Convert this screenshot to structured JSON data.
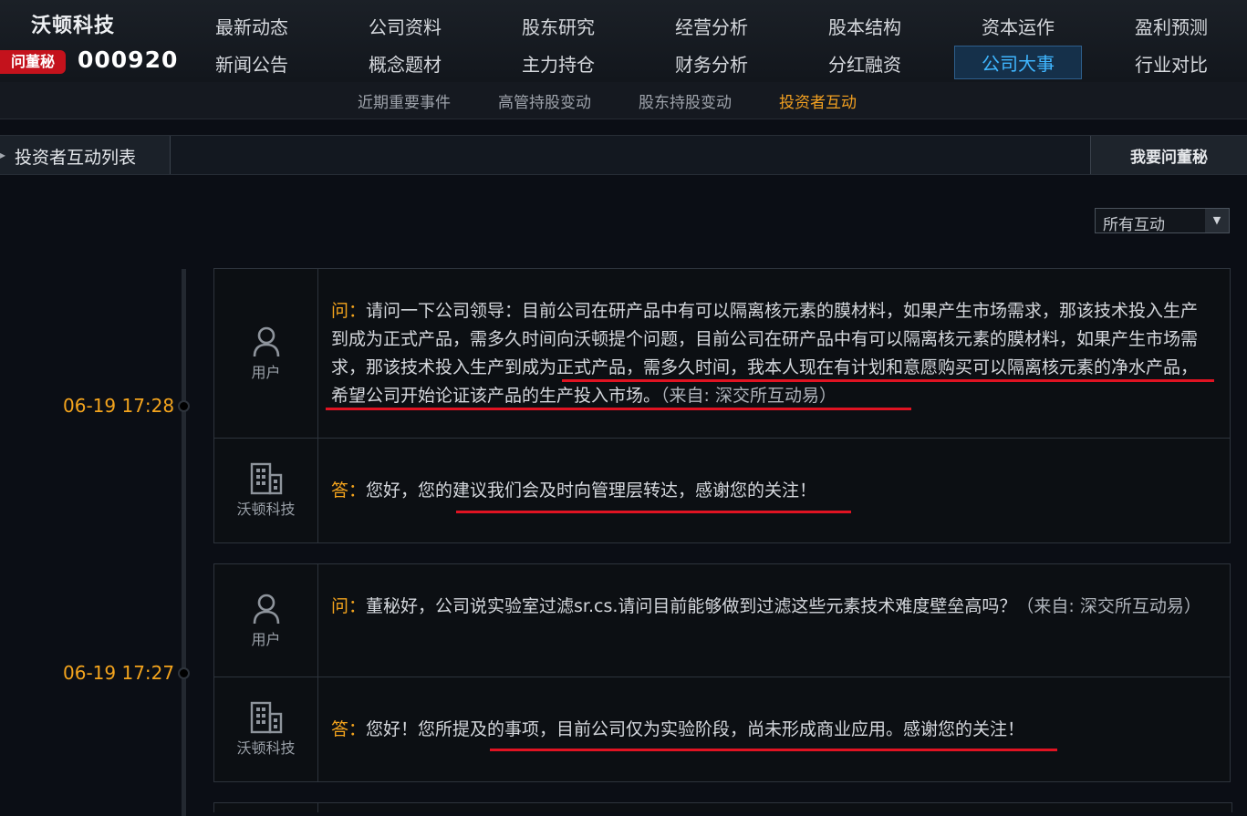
{
  "header": {
    "company_name": "沃顿科技",
    "badge_label": "问董秘",
    "stock_code": "000920"
  },
  "nav": {
    "row1": [
      "最新动态",
      "公司资料",
      "股东研究",
      "经营分析",
      "股本结构",
      "资本运作",
      "盈利预测"
    ],
    "row2": [
      "新闻公告",
      "概念题材",
      "主力持仓",
      "财务分析",
      "分红融资",
      "公司大事",
      "行业对比"
    ],
    "active": "公司大事"
  },
  "subnav": {
    "items": [
      "近期重要事件",
      "高管持股变动",
      "股东持股变动",
      "投资者互动"
    ],
    "active": "投资者互动"
  },
  "section": {
    "title": "投资者互动列表",
    "ask_button": "我要问董秘"
  },
  "filter": {
    "selected": "所有互动"
  },
  "icons": {
    "user": "user-icon",
    "company": "building-icon",
    "dropdown": "chevron-down-icon"
  },
  "colors": {
    "accent_orange": "#f4a41d",
    "accent_blue": "#3fb6ff",
    "highlight_red": "#e01322",
    "badge_red": "#c4121c"
  },
  "interactions": [
    {
      "time": "06-19 17:28",
      "question": {
        "author": "用户",
        "prefix": "问：",
        "text": "请问一下公司领导：目前公司在研产品中有可以隔离核元素的膜材料，如果产生市场需求，那该技术投入生产到成为正式产品，需多久时间向沃顿提个问题，目前公司在研产品中有可以隔离核元素的膜材料，如果产生市场需求，那该技术投入生产到成为正式产品，需多久时间，我本人现在有计划和意愿购买可以隔离核元素的净水产品，希望公司开始论证该产品的生产投入市场。",
        "source": "（来自: 深交所互动易）"
      },
      "answer": {
        "author": "沃顿科技",
        "prefix": "答：",
        "text": "您好，您的建议我们会及时向管理层转达，感谢您的关注！"
      }
    },
    {
      "time": "06-19 17:27",
      "question": {
        "author": "用户",
        "prefix": "问：",
        "text": "董秘好，公司说实验室过滤sr.cs.请问目前能够做到过滤这些元素技术难度壁垒高吗？",
        "source": "（来自: 深交所互动易）"
      },
      "answer": {
        "author": "沃顿科技",
        "prefix": "答：",
        "text": "您好！您所提及的事项，目前公司仅为实验阶段，尚未形成商业应用。感谢您的关注！"
      }
    }
  ]
}
